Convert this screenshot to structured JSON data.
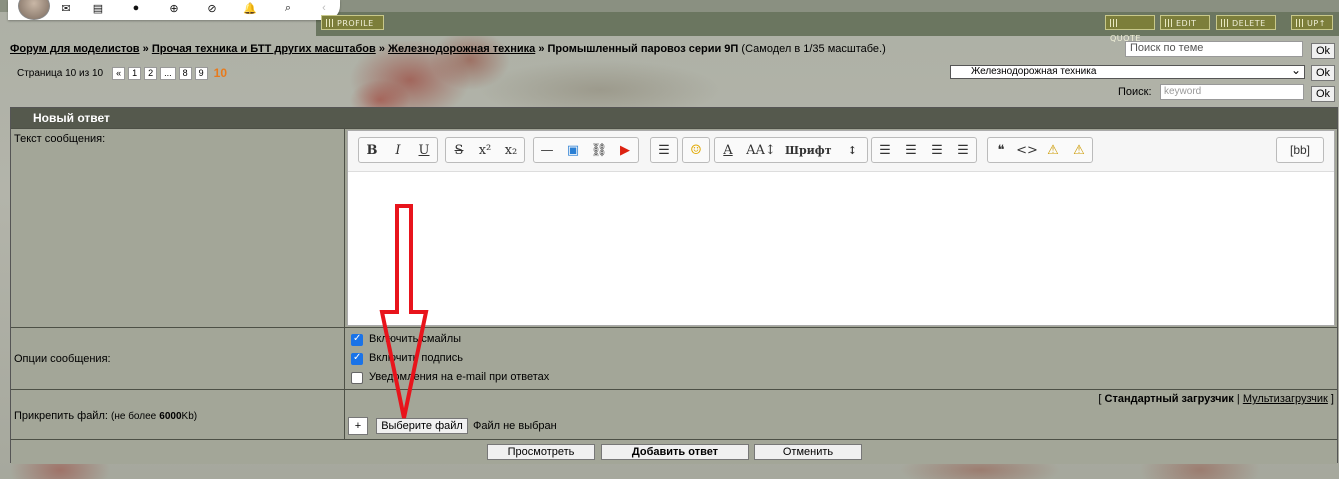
{
  "topbar": {
    "icons": [
      "mail-icon",
      "document-icon",
      "chat-icon",
      "plus-circle-icon",
      "block-icon",
      "bell-icon",
      "search-icon",
      "chevron-left-icon"
    ],
    "profile": "PROFILE",
    "quote": "QUOTE",
    "edit": "EDIT",
    "delete": "DELETE",
    "up": "UP"
  },
  "breadcrumb": {
    "items": [
      "Форум для моделистов",
      "Прочая техника и БТТ других масштабов",
      "Железнодорожная техника"
    ],
    "sep": "»",
    "current": "Промышленный паровоз серии 9П",
    "note": "(Самодел в 1/35 масштабе.)"
  },
  "topic_search": {
    "placeholder": "Поиск по теме",
    "ok": "Ok"
  },
  "pagination": {
    "label": "Страница 10 из 10",
    "prev": "«",
    "pages": [
      "1",
      "2",
      "...",
      "8",
      "9"
    ],
    "current": "10"
  },
  "forum_select": {
    "value": "Железнодорожная техника",
    "ok": "Ok"
  },
  "keyword_search": {
    "label": "Поиск:",
    "placeholder": "keyword",
    "ok": "Ok"
  },
  "form": {
    "title": "Новый ответ",
    "message_label": "Текст сообщения:",
    "toolbar": {
      "bb": "[bb]",
      "font": "Шрифт"
    },
    "options_label": "Опции сообщения:",
    "options": [
      {
        "label": "Включить смайлы",
        "checked": true
      },
      {
        "label": "Включить подпись",
        "checked": true
      },
      {
        "label": "Уведомления на e-mail при ответах",
        "checked": false
      }
    ],
    "attach_label": "Прикрепить файл:",
    "attach_note_prefix": "(не более",
    "attach_size": "6000",
    "attach_note_suffix": "Kb)",
    "uploader_standard": "Стандартный загрузчик",
    "uploader_multi": "Мультизагрузчик",
    "add": "+",
    "choose_file": "Выберите файл",
    "no_file": "Файл не выбран",
    "preview": "Просмотреть",
    "submit": "Добавить ответ",
    "cancel": "Отменить"
  },
  "accent": "#e8141c"
}
